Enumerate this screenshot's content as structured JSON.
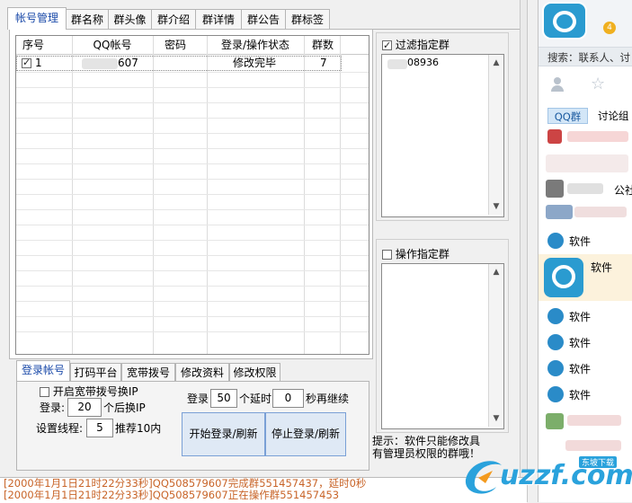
{
  "top_tabs": [
    "帐号管理",
    "群名称",
    "群头像",
    "群介绍",
    "群详情",
    "群公告",
    "群标签"
  ],
  "table": {
    "columns": [
      "序号",
      "QQ帐号",
      "密码",
      "登录/操作状态",
      "群数"
    ],
    "rows": [
      {
        "checked": true,
        "index": "1",
        "qq": "607",
        "password": "",
        "status": "修改完毕",
        "groups": "7"
      }
    ]
  },
  "filter": {
    "label": "过滤指定群",
    "checked": true,
    "items": [
      "08936"
    ]
  },
  "operate": {
    "label": "操作指定群",
    "checked": false
  },
  "hint": "提示：软件只能修改具有管理员权限的群哦！",
  "bottom_tabs": [
    "登录帐号",
    "打码平台",
    "宽带拨号",
    "修改资料",
    "修改权限"
  ],
  "settings": {
    "broadband_label": "开启宽带拨号换IP",
    "login_label": "登录:",
    "login_value": "20",
    "change_ip_label": "个后换IP",
    "threads_label": "设置线程:",
    "threads_value": "5",
    "recommend_label": "推荐10内",
    "login2_label": "登录",
    "login2_value": "50",
    "delay_label": "个延时",
    "delay_value": "0",
    "resume_label": "秒再继续",
    "start_button": "开始登录/刷新",
    "stop_button": "停止登录/刷新"
  },
  "log_lines": [
    "[2000年1月1日21时22分33秒]QQ508579607完成群551457437，延时0秒",
    "[2000年1月1日21时22分33秒]QQ508579607正在操作群551457453"
  ],
  "qq_panel": {
    "search_text": "搜索：联系人、讨",
    "tabs": [
      "QQ群",
      "讨论组"
    ],
    "items": [
      "软件",
      "软件",
      "软件",
      "软件",
      "软件",
      "软件"
    ],
    "badge_text": "4",
    "partial_label": "公社"
  },
  "watermark": {
    "domain": "uzzf.com",
    "tagline": "东坡下载"
  }
}
